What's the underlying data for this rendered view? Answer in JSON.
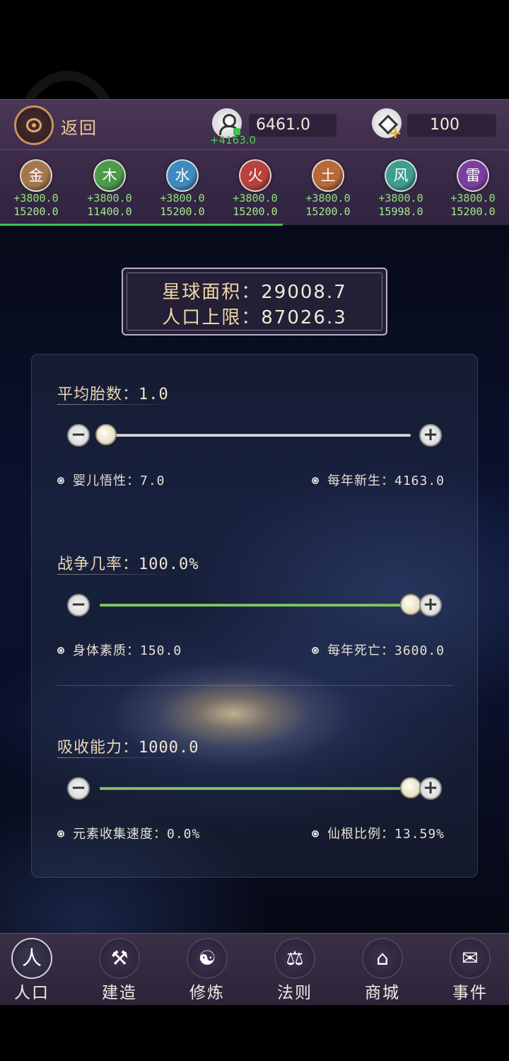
{
  "header": {
    "back_label": "返回",
    "population": "6461.0",
    "population_gain": "+4163.0",
    "gems": "100"
  },
  "elements": [
    {
      "name": "金",
      "gain": "+3800.0",
      "total": "15200.0",
      "color": "#a4764c"
    },
    {
      "name": "木",
      "gain": "+3800.0",
      "total": "11400.0",
      "color": "#4c9a4a"
    },
    {
      "name": "水",
      "gain": "+3800.0",
      "total": "15200.0",
      "color": "#3f8bbf"
    },
    {
      "name": "火",
      "gain": "+3800.0",
      "total": "15200.0",
      "color": "#b8423c"
    },
    {
      "name": "土",
      "gain": "+3800.0",
      "total": "15200.0",
      "color": "#b8693a"
    },
    {
      "name": "风",
      "gain": "+3800.0",
      "total": "15998.0",
      "color": "#3f9e8e"
    },
    {
      "name": "雷",
      "gain": "+3800.0",
      "total": "15200.0",
      "color": "#7a3f9e"
    }
  ],
  "planet": {
    "area_label": "星球面积：",
    "area_value": "29008.7",
    "pop_limit_label": "人口上限：",
    "pop_limit_value": "87026.3"
  },
  "controls": [
    {
      "title": "平均胎数：",
      "value": "1.0",
      "level": 0.02,
      "left_stat_label": "婴儿悟性：",
      "left_stat_value": "7.0",
      "right_stat_label": "每年新生：",
      "right_stat_value": "4163.0"
    },
    {
      "title": "战争几率：",
      "value": "100.0%",
      "level": 1.0,
      "left_stat_label": "身体素质：",
      "left_stat_value": "150.0",
      "right_stat_label": "每年死亡：",
      "right_stat_value": "3600.0"
    },
    {
      "title": "吸收能力：",
      "value": "1000.0",
      "level": 1.0,
      "left_stat_label": "元素收集速度：",
      "left_stat_value": "0.0%",
      "right_stat_label": "仙根比例：",
      "right_stat_value": "13.59%"
    }
  ],
  "nav": [
    {
      "label": "人口",
      "icon": "population-icon",
      "active": true
    },
    {
      "label": "建造",
      "icon": "build-icon",
      "active": false
    },
    {
      "label": "修炼",
      "icon": "meditate-icon",
      "active": false
    },
    {
      "label": "法则",
      "icon": "law-icon",
      "active": false
    },
    {
      "label": "商城",
      "icon": "shop-icon",
      "active": false
    },
    {
      "label": "事件",
      "icon": "event-icon",
      "active": false
    }
  ],
  "colors": {
    "accent_green": "#3fbf4a",
    "gold_text": "#efc79a",
    "header_bg": "#4b3656"
  }
}
